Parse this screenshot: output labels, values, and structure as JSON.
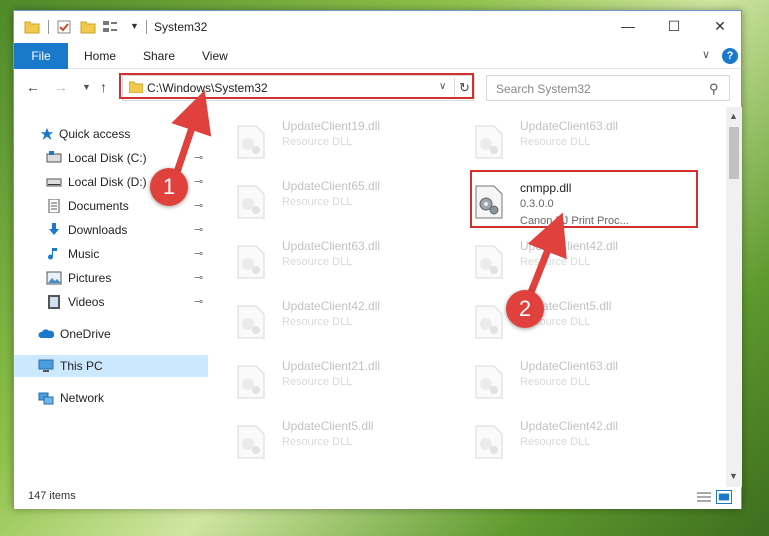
{
  "window": {
    "title": "System32",
    "controls": {
      "minimize": "—",
      "maximize": "☐",
      "close": "✕"
    }
  },
  "ribbon": {
    "tabs": {
      "file": "File",
      "home": "Home",
      "share": "Share",
      "view": "View"
    },
    "expand": "∨",
    "help": "?"
  },
  "addressbar": {
    "path": "C:\\Windows\\System32",
    "dropdown": "∨",
    "refresh": "↻"
  },
  "search": {
    "placeholder": "Search System32",
    "icon": "search-icon"
  },
  "navpane": {
    "items": [
      {
        "label": "Quick access",
        "icon": "star-icon",
        "pinned": false
      },
      {
        "label": "Local Disk (C:)",
        "icon": "drive-icon",
        "pinned": true
      },
      {
        "label": "Local Disk (D:)",
        "icon": "drive-icon",
        "pinned": true
      },
      {
        "label": "Documents",
        "icon": "documents-icon",
        "pinned": true
      },
      {
        "label": "Downloads",
        "icon": "downloads-icon",
        "pinned": true
      },
      {
        "label": "Music",
        "icon": "music-icon",
        "pinned": true
      },
      {
        "label": "Pictures",
        "icon": "pictures-icon",
        "pinned": true
      },
      {
        "label": "Videos",
        "icon": "videos-icon",
        "pinned": true
      },
      {
        "label": "OneDrive",
        "icon": "onedrive-icon",
        "pinned": false
      },
      {
        "label": "This PC",
        "icon": "pc-icon",
        "pinned": false
      },
      {
        "label": "Network",
        "icon": "network-icon",
        "pinned": false
      }
    ],
    "pin_glyph": "📌"
  },
  "files": {
    "left": [
      {
        "name": "UpdateClient19.dll",
        "desc": "Resource DLL"
      },
      {
        "name": "UpdateClient65.dll",
        "desc": "Resource DLL"
      },
      {
        "name": "UpdateClient63.dll",
        "desc": "Resource DLL"
      },
      {
        "name": "UpdateClient42.dll",
        "desc": "Resource DLL"
      },
      {
        "name": "UpdateClient21.dll",
        "desc": "Resource DLL"
      },
      {
        "name": "UpdateClient5.dll",
        "desc": "Resource DLL"
      }
    ],
    "right": [
      {
        "name": "UpdateClient63.dll",
        "desc": "Resource DLL"
      },
      {
        "name": "UpdateClient42.dll",
        "desc": "Resource DLL"
      },
      {
        "name": "UpdateClient5.dll",
        "desc": "Resource DLL"
      },
      {
        "name": "UpdateClient63.dll",
        "desc": "Resource DLL"
      },
      {
        "name": "UpdateClient42.dll",
        "desc": "Resource DLL"
      }
    ],
    "highlighted": {
      "name": "cnmpp.dll",
      "version": "0.3.0.0",
      "desc": "Canon BJ Print Proc..."
    }
  },
  "status": {
    "count": "147 items"
  },
  "annotations": {
    "step1": "1",
    "step2": "2",
    "color": "#d0312f"
  }
}
